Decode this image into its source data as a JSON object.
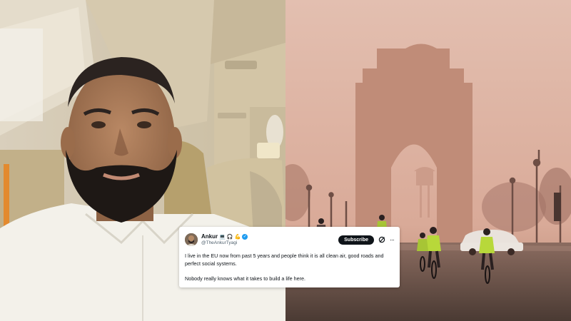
{
  "tweet": {
    "display_name": "Ankur",
    "emojis": [
      "💻",
      "🎧",
      "💪"
    ],
    "handle": "@TheAnkurTyagi",
    "subscribe_label": "Subscribe",
    "paragraphs": [
      "I live in the EU now from past 5 years and people think it is all clean air, good roads and perfect social systems.",
      "Nobody really knows what it takes to build a life here."
    ],
    "more_glyph": "···",
    "verified_glyph": "✓"
  },
  "colors": {
    "smog_sky": "#e3bfb0",
    "subscribe_bg": "#0f1419",
    "verified_blue": "#1d9bf0",
    "hi_vis_green": "#b8d83a"
  },
  "icons": {
    "grok": "grok-icon",
    "more": "more-icon",
    "verified": "verified-badge-icon"
  }
}
